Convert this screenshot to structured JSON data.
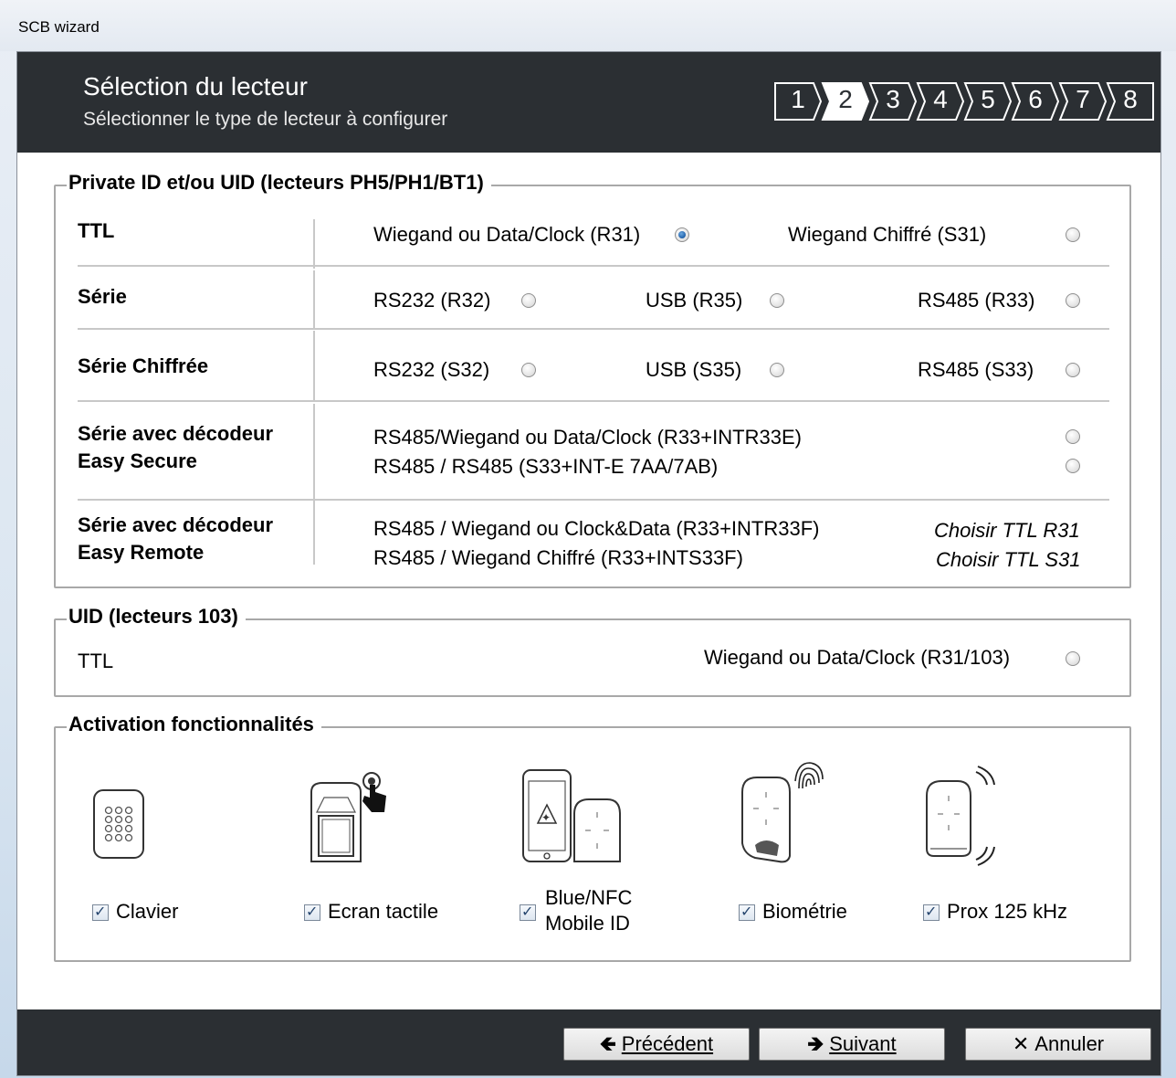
{
  "window": {
    "title": "SCB wizard"
  },
  "header": {
    "title": "Sélection du lecteur",
    "subtitle": "Sélectionner le type de lecteur à configurer",
    "steps": [
      "1",
      "2",
      "3",
      "4",
      "5",
      "6",
      "7",
      "8"
    ],
    "active_step": "2"
  },
  "private": {
    "legend": "Private ID et/ou UID (lecteurs PH5/PH1/BT1)",
    "ttl": {
      "label": "TTL",
      "opt1": "Wiegand ou Data/Clock (R31)",
      "opt2": "Wiegand Chiffré (S31)"
    },
    "serie": {
      "label": "Série",
      "opt1": "RS232 (R32)",
      "opt2": "USB (R35)",
      "opt3": "RS485 (R33)"
    },
    "serie_chiffree": {
      "label": "Série Chiffrée",
      "opt1": "RS232 (S32)",
      "opt2": "USB (S35)",
      "opt3": "RS485 (S33)"
    },
    "easy_secure": {
      "label1": "Série avec décodeur",
      "label2": "Easy Secure",
      "opt1": "RS485/Wiegand ou Data/Clock (R33+INTR33E)",
      "opt2": "RS485 / RS485 (S33+INT-E 7AA/7AB)"
    },
    "easy_remote": {
      "label1": "Série avec décodeur",
      "label2": "Easy Remote",
      "opt1": "RS485 / Wiegand ou Clock&Data (R33+INTR33F)",
      "opt2": "RS485 / Wiegand Chiffré (R33+INTS33F)",
      "hint1": "Choisir TTL R31",
      "hint2": "Choisir TTL S31"
    }
  },
  "uid": {
    "legend": "UID (lecteurs 103)",
    "label": "TTL",
    "opt1": "Wiegand ou Data/Clock (R31/103)"
  },
  "features": {
    "legend": "Activation fonctionnalités",
    "clavier": "Clavier",
    "ecran": "Ecran tactile",
    "blue1": "Blue/NFC",
    "blue2": "Mobile ID",
    "bio": "Biométrie",
    "prox": "Prox 125 kHz"
  },
  "footer": {
    "prev": "Précédent",
    "next": "Suivant",
    "cancel": "Annuler"
  }
}
